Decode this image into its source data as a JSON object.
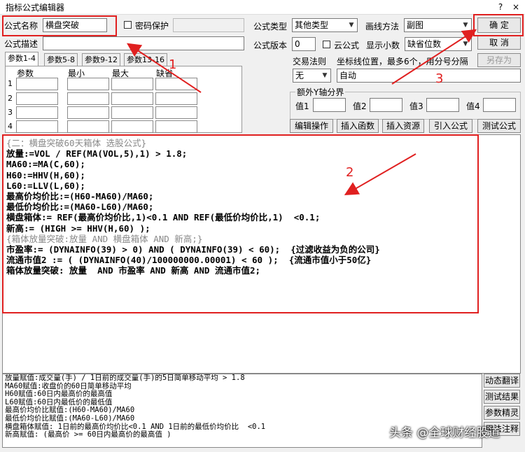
{
  "window": {
    "title": "指标公式编辑器",
    "help": "?",
    "close": "×"
  },
  "form": {
    "name_label": "公式名称",
    "name_value": "横盘突破",
    "password_label": "密码保护",
    "desc_label": "公式描述",
    "type_label": "公式类型",
    "type_value": "其他类型",
    "draw_label": "画线方法",
    "draw_value": "副图",
    "version_label": "公式版本",
    "version_value": "0",
    "cloud_label": "云公式",
    "decimals_label": "显示小数",
    "decimals_value": "缺省位数",
    "trade_label": "交易法则",
    "trade_value": "无",
    "coord_label": "坐标线位置，最多6个，用分号分隔",
    "coord_value": "自动",
    "extra_axis_label": "额外Y轴分界",
    "axis": [
      {
        "label": "值1"
      },
      {
        "label": "值2"
      },
      {
        "label": "值3"
      },
      {
        "label": "值4"
      }
    ]
  },
  "buttons": {
    "ok": "确  定",
    "cancel": "取  消",
    "save_as": "另存为",
    "edit_ops": "编辑操作",
    "insert_func": "插入函数",
    "insert_res": "插入资源",
    "import_formula": "引入公式",
    "test_formula": "测试公式"
  },
  "tabs": [
    "参数1-4",
    "参数5-8",
    "参数9-12",
    "参数13-16"
  ],
  "param_headers": [
    "参数",
    "最小",
    "最大",
    "缺省"
  ],
  "param_rows": [
    "1",
    "2",
    "3",
    "4"
  ],
  "code_lines": [
    "{二：横盘突破60天箱体 选股公式}",
    "放量:=VOL / REF(MA(VOL,5),1) > 1.8;",
    "MA60:=MA(C,60);",
    "H60:=HHV(H,60);",
    "L60:=LLV(L,60);",
    "最高价均价比:=(H60-MA60)/MA60;",
    "最低价均价比:=(MA60-L60)/MA60;",
    "横盘箱体:= REF(最高价均价比,1)<0.1 AND REF(最低价均价比,1)  <0.1;",
    "新高:= (HIGH >= HHV(H,60) );",
    "{箱体放量突破:放量 AND 横盘箱体 AND 新高;}",
    "市盈率:= (DYNAINFO(39) > 0) AND ( DYNAINFO(39) < 60);  {过滤收益为负的公司}",
    "流通市值2 := ( (DYNAINFO(40)/100000000.00001) < 60 );  {流通市值小于50亿}",
    "箱体放量突破: 放量  AND 市盈率 AND 新高 AND 流通市值2;"
  ],
  "output_lines": [
    "放量赋值:成交量(手) / 1日前的成交量(手)的5日简单移动平均 > 1.8",
    "MA60赋值:收盘价的60日简单移动平均",
    "H60赋值:60日内最高价的最高值",
    "L60赋值:60日内最低价的最低值",
    "最高价均价比赋值:(H60-MA60)/MA60",
    "最低价均价比赋值:(MA60-L60)/MA60",
    "横盘箱体赋值: 1日前的最高价均价比<0.1 AND 1日前的最低价均价比  <0.1",
    "新高赋值: (最高价 >= 60日内最高价的最高值 )"
  ],
  "side_buttons": [
    "动态翻译",
    "测试结果",
    "参数精灵",
    "用法注释"
  ],
  "annotations": [
    "1",
    "2",
    "3"
  ],
  "watermark": "头条 @全球财经股道"
}
